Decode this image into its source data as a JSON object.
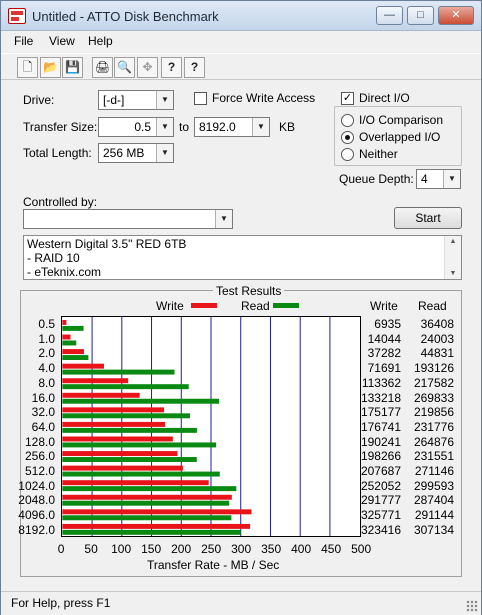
{
  "window": {
    "title": "Untitled - ATTO Disk Benchmark",
    "minimize": "—",
    "maximize": "□",
    "close": "✕"
  },
  "menu": [
    "File",
    "View",
    "Help"
  ],
  "toolbar": {
    "icons": [
      "new-icon",
      "open-icon",
      "save-icon",
      "print-icon",
      "print-preview-icon",
      "move-icon",
      "help-icon",
      "context-help-icon"
    ],
    "glyphs": [
      "🗋",
      "📂",
      "💾",
      "🖨",
      "🔍",
      "✥",
      "?",
      "?"
    ]
  },
  "form": {
    "drive_label": "Drive:",
    "drive_value": "[-d-]",
    "force_write_label": "Force Write Access",
    "direct_io_label": "Direct I/O",
    "transfer_size_label": "Transfer Size:",
    "transfer_from": "0.5",
    "to_label": "to",
    "transfer_to": "8192.0",
    "kb_label": "KB",
    "total_length_label": "Total Length:",
    "total_length_value": "256 MB",
    "io_comparison_label": "I/O Comparison",
    "overlapped_io_label": "Overlapped I/O",
    "neither_label": "Neither",
    "queue_depth_label": "Queue Depth:",
    "queue_depth_value": "4",
    "controlled_by_label": "Controlled by:",
    "controlled_by_value": "",
    "start_label": "Start",
    "notes": [
      "Western Digital 3.5\" RED 6TB",
      "- RAID 10",
      "- eTeknix.com"
    ]
  },
  "colors": {
    "write": "#e8141a",
    "read": "#0a8a12",
    "gridline": "#1a1aa6"
  },
  "chart_data": {
    "type": "bar",
    "title": "Test Results",
    "xlabel": "Transfer Rate - MB / Sec",
    "ylabel": "",
    "xlim": [
      0,
      500
    ],
    "xticks": [
      "0",
      "50",
      "100",
      "150",
      "200",
      "250",
      "300",
      "350",
      "400",
      "450",
      "500"
    ],
    "legend": [
      "Write",
      "Read"
    ],
    "column_headers": [
      "Write",
      "Read"
    ],
    "categories": [
      "0.5",
      "1.0",
      "2.0",
      "4.0",
      "8.0",
      "16.0",
      "32.0",
      "64.0",
      "128.0",
      "256.0",
      "512.0",
      "1024.0",
      "2048.0",
      "4096.0",
      "8192.0"
    ],
    "series": [
      {
        "name": "Write",
        "values": [
          6.8,
          13.7,
          36.4,
          70.0,
          110.7,
          130.1,
          171.1,
          172.6,
          185.8,
          193.6,
          202.8,
          246.1,
          285.0,
          318.1,
          315.8
        ]
      },
      {
        "name": "Read",
        "values": [
          35.6,
          23.4,
          43.8,
          188.6,
          212.5,
          263.5,
          214.7,
          226.3,
          258.7,
          226.1,
          264.8,
          292.6,
          280.6,
          284.3,
          300.0
        ]
      }
    ],
    "table": {
      "write": [
        "6935",
        "14044",
        "37282",
        "71691",
        "113362",
        "133218",
        "175177",
        "176741",
        "190241",
        "198266",
        "207687",
        "252052",
        "291777",
        "325771",
        "323416"
      ],
      "read": [
        "36408",
        "24003",
        "44831",
        "193126",
        "217582",
        "269833",
        "219856",
        "231776",
        "264876",
        "231551",
        "271146",
        "299593",
        "287404",
        "291144",
        "307134"
      ]
    }
  },
  "status": {
    "text": "For Help, press F1"
  }
}
